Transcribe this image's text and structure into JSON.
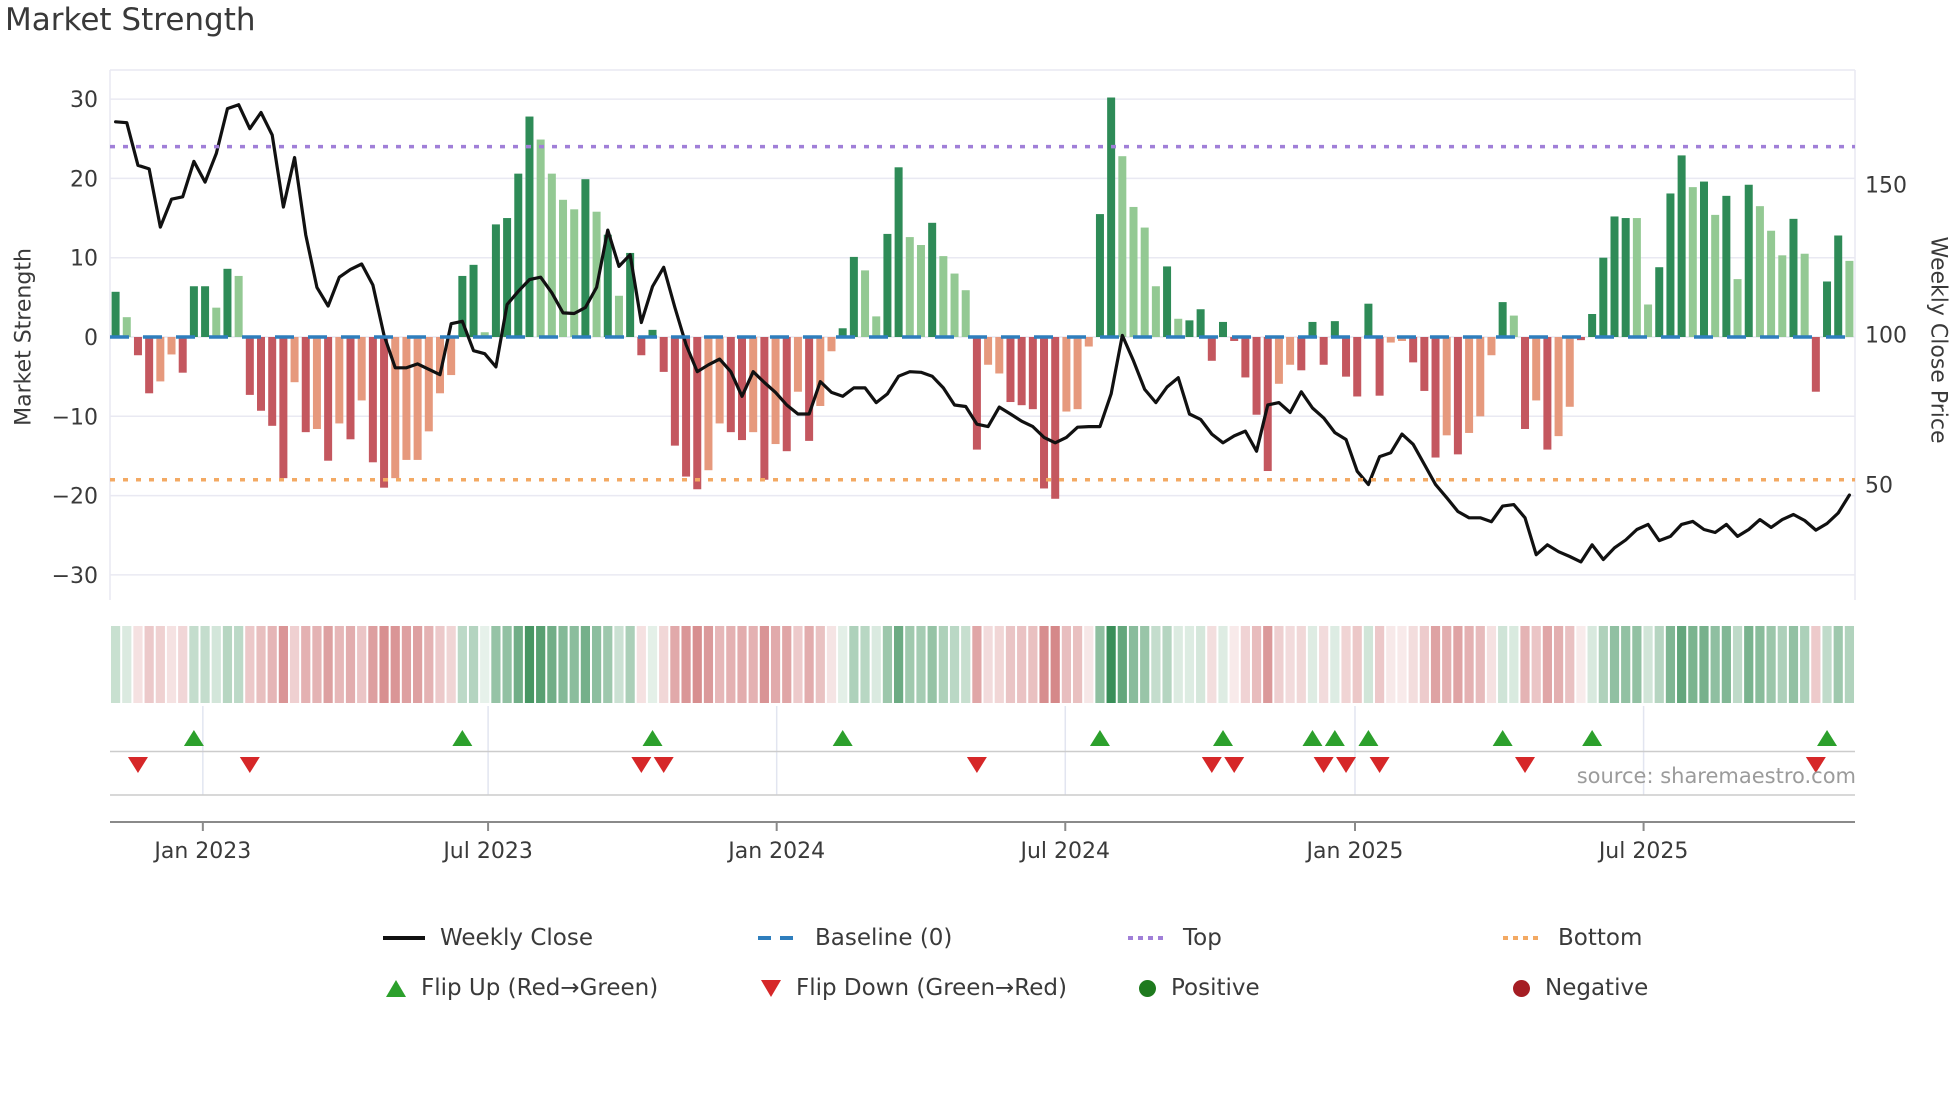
{
  "title": "Market Strength",
  "source": "source: sharemaestro.com",
  "axes": {
    "left_label": "Market Strength",
    "right_label": "Weekly Close Price",
    "left_ticks": [
      30,
      20,
      10,
      0,
      -10,
      -20,
      -30
    ],
    "right_ticks": [
      150,
      100,
      50
    ],
    "x_ticks": [
      {
        "label": "Jan 2023",
        "week": 8.3
      },
      {
        "label": "Jul 2023",
        "week": 33.8
      },
      {
        "label": "Jan 2024",
        "week": 59.6
      },
      {
        "label": "Jul 2024",
        "week": 85.4
      },
      {
        "label": "Jan 2025",
        "week": 111.3
      },
      {
        "label": "Jul 2025",
        "week": 137.1
      }
    ]
  },
  "legend": {
    "weekly_close": "Weekly Close",
    "baseline": "Baseline (0)",
    "top": "Top",
    "bottom": "Bottom",
    "flip_up": "Flip Up (Red→Green)",
    "flip_down": "Flip Down (Green→Red)",
    "positive": "Positive",
    "negative": "Negative"
  },
  "colors": {
    "bar_green_dark": "#2e8b57",
    "bar_green_light": "#93c993",
    "bar_red_dark": "#c4575f",
    "bar_red_light": "#e6997d",
    "close_line": "#111111",
    "baseline": "#2e7ebd",
    "top_line": "#a07fd8",
    "bottom_line": "#f3a963",
    "flip_up": "#2ca02c",
    "flip_down": "#d62728",
    "positive_dot": "#1e7a1e",
    "negative_dot": "#a51d23",
    "grid": "#e9e9f2",
    "band_grid": "#e2e5f0",
    "separator": "#cccccc",
    "axis_line": "#8a8a8a",
    "tick_text": "#3a3a3a",
    "heat_green_base": [
      36,
      130,
      70
    ],
    "heat_red_base": [
      190,
      70,
      72
    ]
  },
  "chart_data": [
    {
      "type": "bar",
      "name": "market_strength",
      "ylabel": "Market Strength",
      "ylim": [
        -33.5,
        33.5
      ],
      "grid": true,
      "baseline_value": 0,
      "top_value": 24,
      "bottom_value": -18,
      "x_unit": "weeks starting early Nov 2022, one bar per week",
      "shades": "DLDDLLDDDLDLDDDDLDLDLDLDDLLLLLLDDLDDDDLLLLDLDLDDDDDDDLLDDLDLDLDLLDDLLDDLLDLLLDLLDDDDDLLLDDLLLLDLDDDDDDDDLLDDDDDDDDLLDDDLDLLLDLDLDLLDDDDDLLDDDLDLDLDLLLDLDDDL",
      "values": [
        5.7,
        2.5,
        -2.3,
        -7.1,
        -5.6,
        -2.2,
        -4.5,
        6.4,
        6.4,
        3.7,
        8.6,
        7.7,
        -7.3,
        -9.3,
        -11.2,
        -17.8,
        -5.7,
        -12.0,
        -11.6,
        -15.6,
        -10.9,
        -12.9,
        -8.0,
        -15.8,
        -19.0,
        -17.8,
        -15.5,
        -15.5,
        -11.9,
        -7.1,
        -4.8,
        7.7,
        9.1,
        0.6,
        14.2,
        15.0,
        20.6,
        27.8,
        24.9,
        20.6,
        17.3,
        16.1,
        19.9,
        15.8,
        12.9,
        5.2,
        10.6,
        -2.3,
        0.9,
        -4.4,
        -13.7,
        -17.6,
        -19.2,
        -16.8,
        -10.9,
        -12.0,
        -13.0,
        -12.0,
        -18.0,
        -13.5,
        -14.4,
        -6.9,
        -13.1,
        -8.7,
        -1.8,
        1.1,
        10.1,
        8.4,
        2.6,
        13.0,
        21.4,
        12.6,
        11.6,
        14.4,
        10.2,
        8.0,
        5.9,
        -14.2,
        -3.5,
        -4.6,
        -8.2,
        -8.6,
        -9.1,
        -19.1,
        -20.4,
        -9.4,
        -9.1,
        -1.2,
        15.5,
        30.2,
        22.8,
        16.4,
        13.8,
        6.4,
        8.9,
        2.3,
        2.1,
        3.5,
        -3.0,
        1.9,
        -0.5,
        -5.1,
        -9.8,
        -16.9,
        -5.9,
        -3.5,
        -4.2,
        1.9,
        -3.5,
        2.0,
        -5.0,
        -7.5,
        4.2,
        -7.4,
        -0.7,
        -0.5,
        -3.2,
        -6.8,
        -15.2,
        -12.4,
        -14.8,
        -12.1,
        -10.0,
        -2.3,
        4.4,
        2.7,
        -11.6,
        -8.0,
        -14.2,
        -12.5,
        -8.8,
        -0.4,
        2.9,
        10.0,
        15.2,
        15.0,
        15.0,
        4.1,
        8.8,
        18.1,
        22.9,
        18.9,
        19.6,
        15.4,
        17.8,
        7.3,
        19.2,
        16.5,
        13.4,
        10.3,
        14.9,
        10.5,
        -6.9,
        7.0,
        12.8,
        9.6
      ]
    },
    {
      "type": "line",
      "name": "weekly_close",
      "ylabel": "Weekly Close Price",
      "yticks": [
        150,
        100,
        50
      ],
      "ylim": [
        12,
        188
      ],
      "values": [
        170.9,
        170.6,
        156.4,
        155.2,
        135.8,
        145.1,
        145.9,
        157.7,
        150.8,
        160.3,
        175.3,
        176.6,
        168.6,
        174.0,
        166.5,
        142.5,
        159.0,
        133.2,
        115.7,
        109.5,
        119.1,
        121.7,
        123.5,
        116.5,
        99.7,
        88.9,
        88.9,
        90.2,
        88.4,
        86.6,
        103.6,
        104.4,
        94.6,
        93.6,
        89.2,
        110.0,
        114.4,
        118.3,
        119.1,
        113.9,
        107.2,
        107.0,
        109.0,
        115.7,
        134.8,
        122.7,
        126.6,
        104.0,
        116.0,
        122.4,
        109.0,
        96.6,
        87.6,
        89.9,
        91.8,
        87.6,
        79.4,
        87.6,
        84.0,
        80.7,
        76.5,
        73.5,
        73.5,
        84.3,
        80.7,
        79.4,
        82.2,
        82.2,
        77.3,
        80.2,
        86.1,
        87.6,
        87.4,
        86.1,
        82.2,
        76.5,
        76.0,
        70.1,
        69.3,
        75.8,
        73.5,
        71.1,
        69.3,
        65.7,
        63.9,
        65.7,
        69.1,
        69.3,
        69.3,
        80.2,
        99.7,
        91.2,
        81.7,
        77.3,
        82.5,
        85.6,
        73.5,
        71.7,
        66.8,
        63.9,
        66.2,
        67.8,
        61.1,
        76.5,
        77.3,
        74.0,
        80.9,
        75.5,
        72.2,
        67.3,
        65.0,
        54.4,
        50.0,
        59.3,
        60.6,
        66.8,
        63.4,
        56.7,
        50.0,
        45.6,
        41.0,
        38.9,
        38.9,
        37.6,
        42.8,
        43.3,
        38.9,
        26.6,
        29.9,
        27.6,
        26.0,
        24.2,
        29.9,
        25.0,
        28.9,
        31.5,
        35.0,
        36.7,
        31.3,
        32.7,
        36.7,
        37.7,
        35.0,
        34.0,
        36.7,
        32.7,
        35.0,
        38.3,
        35.7,
        38.3,
        40.0,
        38.0,
        34.8,
        37.0,
        40.5,
        46.5
      ]
    },
    {
      "type": "heatmap",
      "name": "strength_heat_strip",
      "note": "single-row strip below main panel; cell color = sign and magnitude of market strength value",
      "derived_from": "market_strength.values"
    },
    {
      "type": "scatter",
      "name": "flip_markers",
      "up_weeks": [
        7,
        31,
        48,
        65,
        88,
        99,
        107,
        109,
        112,
        124,
        132,
        153
      ],
      "down_weeks": [
        2,
        12,
        47,
        49,
        77,
        98,
        100,
        108,
        110,
        113,
        126,
        152
      ]
    }
  ]
}
